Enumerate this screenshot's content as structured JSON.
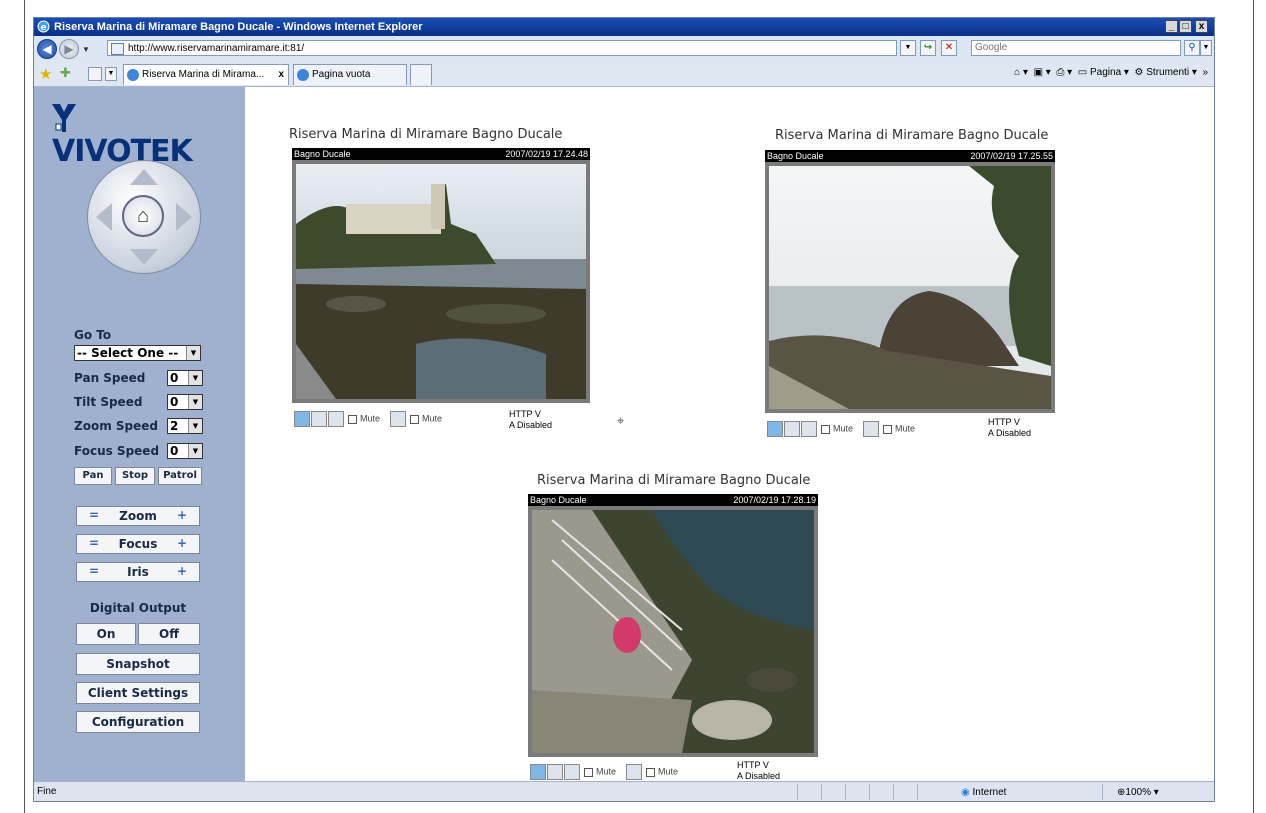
{
  "window": {
    "title": "Riserva Marina di Miramare Bagno Ducale - Windows Internet Explorer",
    "controls": {
      "minimize": "_",
      "maximize": "□",
      "close": "x"
    }
  },
  "address_bar": {
    "url": "http://www.riservamarinamiramare.it:81/",
    "search_placeholder": "Google",
    "go_icon": "↪",
    "stop_icon": "✕",
    "search_icon": "⚲"
  },
  "tabs": [
    {
      "label": "Riserva Marina di Mirama...",
      "close": "x"
    },
    {
      "label": "Pagina vuota"
    }
  ],
  "toolbar_right": {
    "page": "Pagina",
    "tools": "Strumenti"
  },
  "sidebar": {
    "logo": "VIVOTEK",
    "go_to_label": "Go To",
    "go_to_value": "-- Select One --",
    "speeds": [
      {
        "label": "Pan Speed",
        "value": "0"
      },
      {
        "label": "Tilt Speed",
        "value": "0"
      },
      {
        "label": "Zoom Speed",
        "value": "2"
      },
      {
        "label": "Focus Speed",
        "value": "0"
      }
    ],
    "pan_buttons": [
      "Pan",
      "Stop",
      "Patrol"
    ],
    "adjust": [
      {
        "label": "Zoom",
        "minus": "=",
        "plus": "+"
      },
      {
        "label": "Focus",
        "minus": "=",
        "plus": "+"
      },
      {
        "label": "Iris",
        "minus": "=",
        "plus": "+"
      }
    ],
    "digital_output_label": "Digital Output",
    "digital_output": {
      "on": "On",
      "off": "Off"
    },
    "snapshot": "Snapshot",
    "client_settings": "Client Settings",
    "configuration": "Configuration"
  },
  "cameras": [
    {
      "title": "Riserva Marina di Miramare Bagno Ducale",
      "name": "Bagno Ducale",
      "timestamp": "2007/02/19 17.24.48",
      "mute1": "Mute",
      "mute2": "Mute",
      "http": "HTTP V",
      "audio": "A Disabled"
    },
    {
      "title": "Riserva Marina di Miramare Bagno Ducale",
      "name": "Bagno Ducale",
      "timestamp": "2007/02/19 17.25.55",
      "mute1": "Mute",
      "mute2": "Mute",
      "http": "HTTP V",
      "audio": "A Disabled"
    },
    {
      "title": "Riserva Marina di Miramare Bagno Ducale",
      "name": "Bagno Ducale",
      "timestamp": "2007/02/19 17.28.19",
      "mute1": "Mute",
      "mute2": "Mute",
      "http": "HTTP V",
      "audio": "A Disabled"
    }
  ],
  "status_bar": {
    "status": "Fine",
    "zone": "Internet",
    "zoom": "100%"
  },
  "colors": {
    "sidebar": "#9fb1ce",
    "titlebar": "#1a4fb5",
    "brand": "#07307a"
  }
}
